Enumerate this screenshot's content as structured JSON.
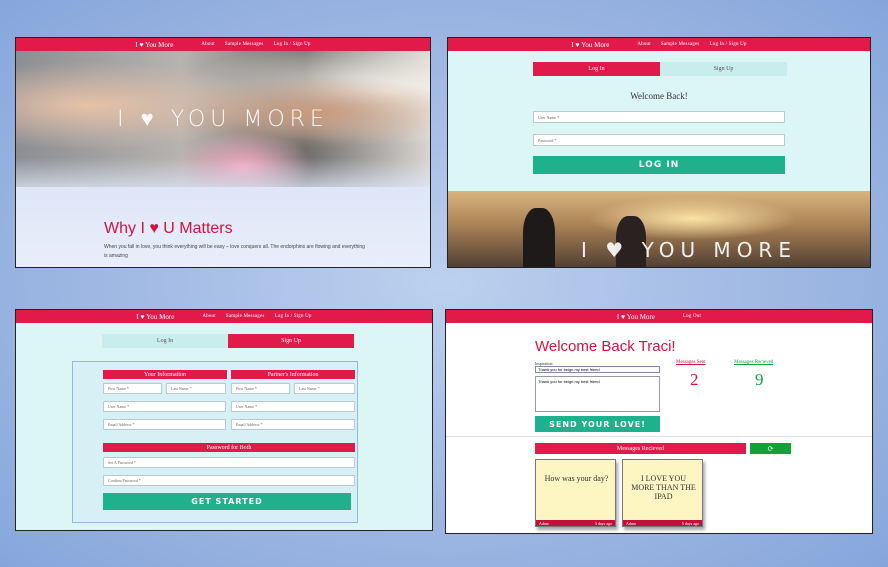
{
  "nav_home": {
    "brand": "I ♥ You More",
    "links": [
      "About",
      "Sample Messages",
      "Log In / Sign Up"
    ]
  },
  "nav_dashboard": {
    "brand": "I ♥ You More",
    "links": [
      "Log Out"
    ]
  },
  "landing": {
    "hero_title": "I ♥ YOU MORE",
    "section_title": "Why I ♥ U Matters",
    "section_text": "When you fall in love, you think everything will be easy – love conquers all. The endorphins are flowing and everything is amazing"
  },
  "login": {
    "tabs": [
      "Log In",
      "Sign Up"
    ],
    "heading": "Welcome Back!",
    "username_placeholder": "User Name *",
    "password_placeholder": "Password *",
    "submit_label": "LOG IN",
    "hero_title": "I ♥ YOU MORE"
  },
  "signup": {
    "tabs": [
      "Log In",
      "Sign Up"
    ],
    "your_info_heading": "Your Information",
    "partner_info_heading": "Partner's Information",
    "first_name": "First Name *",
    "last_name": "Last Name *",
    "user_name": "User Name *",
    "email": "Email Address *",
    "password_heading": "Password for Both",
    "set_password": "Set A Password *",
    "confirm_password": "Confirm Password *",
    "submit_label": "GET STARTED"
  },
  "dashboard": {
    "welcome": "Welcome Back Traci!",
    "inspiration_label": "Inspiration:",
    "inspiration_selected": "Thank you for beign my best friend",
    "message_text": "Thank you for beign my best friend",
    "send_label": "SEND YOUR LOVE!",
    "sent_label": "Messages Sent",
    "sent_count": "2",
    "received_label": "Messages Recieved",
    "received_count": "9",
    "received_heading": "Messages Recieved",
    "refresh_icon": "refresh-icon",
    "cards": [
      {
        "text": "How was your day?",
        "author": "Adam",
        "age": "3 days ago"
      },
      {
        "text": "I LOVE YOU MORE THAN THE IPAD",
        "author": "Adam",
        "age": "5 days ago"
      }
    ]
  },
  "colors": {
    "accent_red": "#e21a4a",
    "accent_green": "#1fb18b",
    "panel_mint": "#dcf6f6"
  }
}
